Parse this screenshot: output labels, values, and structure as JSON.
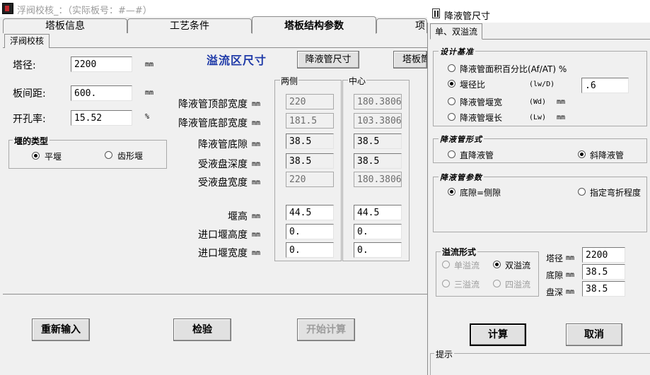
{
  "window": {
    "title": "浮阀校核_：（实际板号：#—#）"
  },
  "tabs": [
    {
      "label": "塔板信息"
    },
    {
      "label": "工艺条件"
    },
    {
      "label": "塔板结构参数"
    },
    {
      "label": "项"
    }
  ],
  "subtab": {
    "label": "浮阀校核"
  },
  "left": {
    "tower_diameter": {
      "label": "塔径:",
      "value": "2200",
      "unit": "mm"
    },
    "plate_spacing": {
      "label": "板间距:",
      "value": "600.",
      "unit": "mm"
    },
    "hole_ratio": {
      "label": "开孔率:",
      "value": "15.52",
      "unit": "%"
    },
    "weir_type": {
      "title": "堰的类型",
      "options": [
        {
          "label": "平堰"
        },
        {
          "label": "齿形堰"
        }
      ]
    }
  },
  "overflow": {
    "title": "溢流区尺寸",
    "downcomer_button": "降液管尺寸",
    "plate_button": "塔板筒",
    "col_side": "两侧",
    "col_center": "中心",
    "rows": [
      {
        "label": "降液管顶部宽度",
        "unit": "mm",
        "side": "220",
        "center": "180.3806",
        "readonly": true
      },
      {
        "label": "降液管底部宽度",
        "unit": "mm",
        "side": "181.5",
        "center": "103.3806",
        "readonly": true
      },
      {
        "label": "降液管底隙",
        "unit": "mm",
        "side": "38.5",
        "center": "38.5",
        "readonly": false
      },
      {
        "label": "受液盘深度",
        "unit": "mm",
        "side": "38.5",
        "center": "38.5",
        "readonly": false
      },
      {
        "label": "受液盘宽度",
        "unit": "mm",
        "side": "220",
        "center": "180.3806",
        "readonly": true
      },
      {
        "label": "堰高",
        "unit": "mm",
        "side": "44.5",
        "center": "44.5",
        "readonly": false
      },
      {
        "label": "进口堰高度",
        "unit": "mm",
        "side": "0.",
        "center": "0.",
        "readonly": false
      },
      {
        "label": "进口堰宽度",
        "unit": "mm",
        "side": "0.",
        "center": "0.",
        "readonly": false
      }
    ]
  },
  "bottom_buttons": {
    "reinput": "重新输入",
    "check": "检验",
    "start": "开始计算"
  },
  "dialog": {
    "title": "降液管尺寸",
    "tab": "单、双溢流",
    "design_criteria": {
      "title": "设计基准",
      "options": [
        {
          "label": "降液管面积百分比(Af/AT) %",
          "symbol": "",
          "unit": ""
        },
        {
          "label": "堰径比",
          "symbol": "(lw/D)",
          "unit": ""
        },
        {
          "label": "降液管堰宽",
          "symbol": "(Wd)",
          "unit": "mm"
        },
        {
          "label": "降液管堰长",
          "symbol": "(Lw)",
          "unit": "mm"
        }
      ],
      "ratio_value": ".6"
    },
    "downcomer_form": {
      "title": "降液管形式",
      "options": [
        {
          "label": "直降液管"
        },
        {
          "label": "斜降液管"
        }
      ]
    },
    "downcomer_params": {
      "title": "降液管参数",
      "options": [
        {
          "label": "底隙=侧隙"
        },
        {
          "label": "指定弯折程度"
        }
      ]
    },
    "overflow_form": {
      "title": "溢流形式",
      "options": [
        {
          "label": "单溢流"
        },
        {
          "label": "双溢流"
        },
        {
          "label": "三溢流"
        },
        {
          "label": "四溢流"
        }
      ]
    },
    "fields": [
      {
        "label": "塔径",
        "unit": "mm",
        "value": "2200"
      },
      {
        "label": "底隙",
        "unit": "mm",
        "value": "38.5"
      },
      {
        "label": "盘深",
        "unit": "mm",
        "value": "38.5"
      }
    ],
    "calc_button": "计算",
    "cancel_button": "取消",
    "hint_title": "提示"
  }
}
